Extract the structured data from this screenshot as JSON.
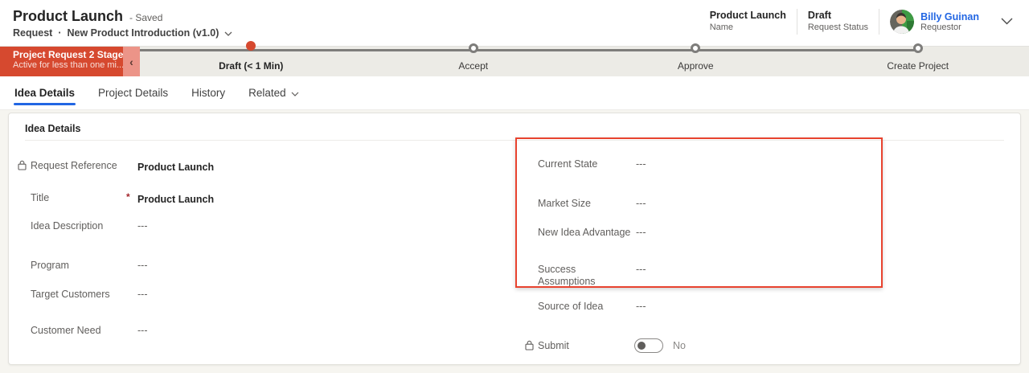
{
  "header": {
    "title": "Product Launch",
    "save_status": "- Saved",
    "entity": "Request",
    "separator": "·",
    "process_version": "New Product Introduction (v1.0)",
    "summary_fields": [
      {
        "value": "Product Launch",
        "label": "Name"
      },
      {
        "value": "Draft",
        "label": "Request Status"
      },
      {
        "value": "Billy Guinan",
        "label": "Requestor"
      }
    ]
  },
  "bpf": {
    "banner": {
      "title": "Project Request 2 Stage",
      "subtitle": "Active for less than one mi...",
      "collapse_glyph": "‹"
    },
    "stages": [
      {
        "label": "Draft  (< 1 Min)",
        "state": "active"
      },
      {
        "label": "Accept",
        "state": "future"
      },
      {
        "label": "Approve",
        "state": "future"
      },
      {
        "label": "Create Project",
        "state": "future"
      }
    ]
  },
  "tabs": [
    {
      "label": "Idea Details"
    },
    {
      "label": "Project Details"
    },
    {
      "label": "History"
    },
    {
      "label": "Related"
    }
  ],
  "section": {
    "title": "Idea Details",
    "fields_left": [
      {
        "label": "Request Reference",
        "value": "Product Launch"
      },
      {
        "label": "Title",
        "value": "Product Launch",
        "required_marker": "*"
      },
      {
        "label": "Idea Description",
        "value": "---"
      },
      {
        "label": "Program",
        "value": "---"
      },
      {
        "label": "Target Customers",
        "value": "---"
      },
      {
        "label": "Customer Need",
        "value": "---"
      }
    ],
    "fields_right": [
      {
        "label": "Current State",
        "value": "---"
      },
      {
        "label": "Market Size",
        "value": "---"
      },
      {
        "label": "New Idea Advantage",
        "value": "---"
      },
      {
        "label": "Success Assumptions",
        "value": "---"
      },
      {
        "label": "Source of Idea",
        "value": "---"
      },
      {
        "label": "Submit",
        "value": "No"
      }
    ]
  },
  "colors": {
    "accent_red": "#D6492F",
    "banner_light_red": "#EC9488",
    "link_blue": "#2266E3",
    "highlight_border": "#E8432F",
    "bpf_bar": "#ECEBE6",
    "bpf_line": "#7E7D7B"
  }
}
